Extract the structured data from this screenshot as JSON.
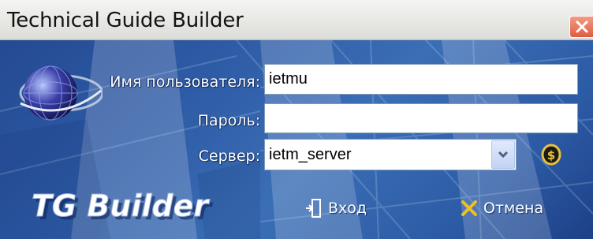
{
  "window": {
    "title": "Technical Guide Builder"
  },
  "form": {
    "username_label": "Имя пользователя:",
    "username_value": "ietmu",
    "password_label": "Пароль:",
    "password_value": "",
    "server_label": "Сервер:",
    "server_value": "ietm_server"
  },
  "logo_text": "TG Builder",
  "buttons": {
    "login": "Вход",
    "cancel": "Отмена"
  },
  "icons": {
    "close": "close-icon",
    "globe": "globe-logo-icon",
    "dropdown": "chevron-down-icon",
    "server": "server-settings-icon",
    "login": "login-door-icon",
    "cancel": "cancel-x-icon"
  },
  "colors": {
    "body_blue": "#2e5ba6",
    "close_red": "#e05c3e",
    "cancel_x": "#f0c020"
  }
}
